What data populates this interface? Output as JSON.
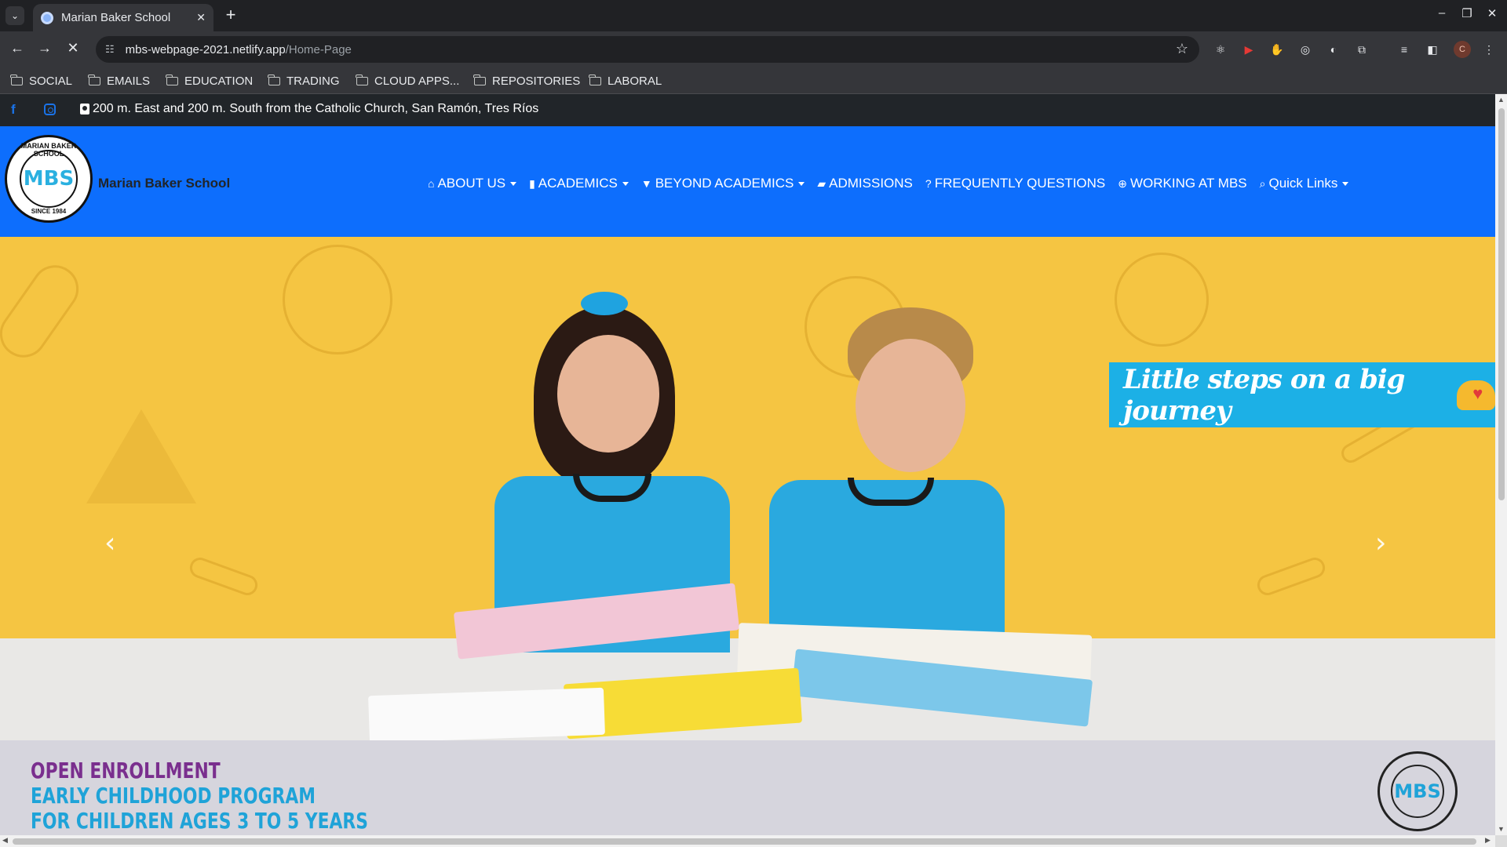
{
  "browser": {
    "tab_title": "Marian Baker School",
    "url_host": "mbs-webpage-2021.netlify.app",
    "url_path": "/Home-Page",
    "profile_initial": "C",
    "bookmarks": [
      "SOCIAL",
      "EMAILS",
      "EDUCATION",
      "TRADING",
      "CLOUD APPS...",
      "REPOSITORIES",
      "LABORAL"
    ]
  },
  "page": {
    "address": "200 m. East and 200 m. South from the Catholic Church, San Ramón, Tres Ríos",
    "brand": "Marian Baker School",
    "logo": {
      "arc_text": "MARIAN BAKER SCHOOL",
      "monogram": "MBS",
      "since": "SINCE 1984"
    },
    "menu": [
      {
        "label": "ABOUT US",
        "icon": "home-icon",
        "dropdown": true
      },
      {
        "label": "ACADEMICS",
        "icon": "book-icon",
        "dropdown": true
      },
      {
        "label": "BEYOND ACADEMICS",
        "icon": "bookmark-icon",
        "dropdown": true
      },
      {
        "label": "ADMISSIONS",
        "icon": "book-open-icon",
        "dropdown": false
      },
      {
        "label": "FREQUENTLY QUESTIONS",
        "icon": "question-icon",
        "dropdown": false
      },
      {
        "label": "WORKING AT MBS",
        "icon": "search-plus-icon",
        "dropdown": false
      },
      {
        "label": "Quick Links",
        "icon": "search-icon",
        "dropdown": true
      }
    ],
    "hero": {
      "slogan": "Little steps on a big journey"
    },
    "banner": {
      "line1": "OPEN ENROLLMENT",
      "line2": "EARLY CHILDHOOD PROGRAM",
      "line3": "FOR CHILDREN AGES 3 TO 5 YEARS"
    }
  },
  "colors": {
    "navbar": "#0d6efd",
    "topbar": "#212529",
    "hero_bg": "#f5c542",
    "slogan_bg": "#1cb0e6",
    "banner_bg": "#d6d5dd",
    "banner_purple": "#7a2f8e",
    "banner_blue": "#1fa3d8"
  }
}
